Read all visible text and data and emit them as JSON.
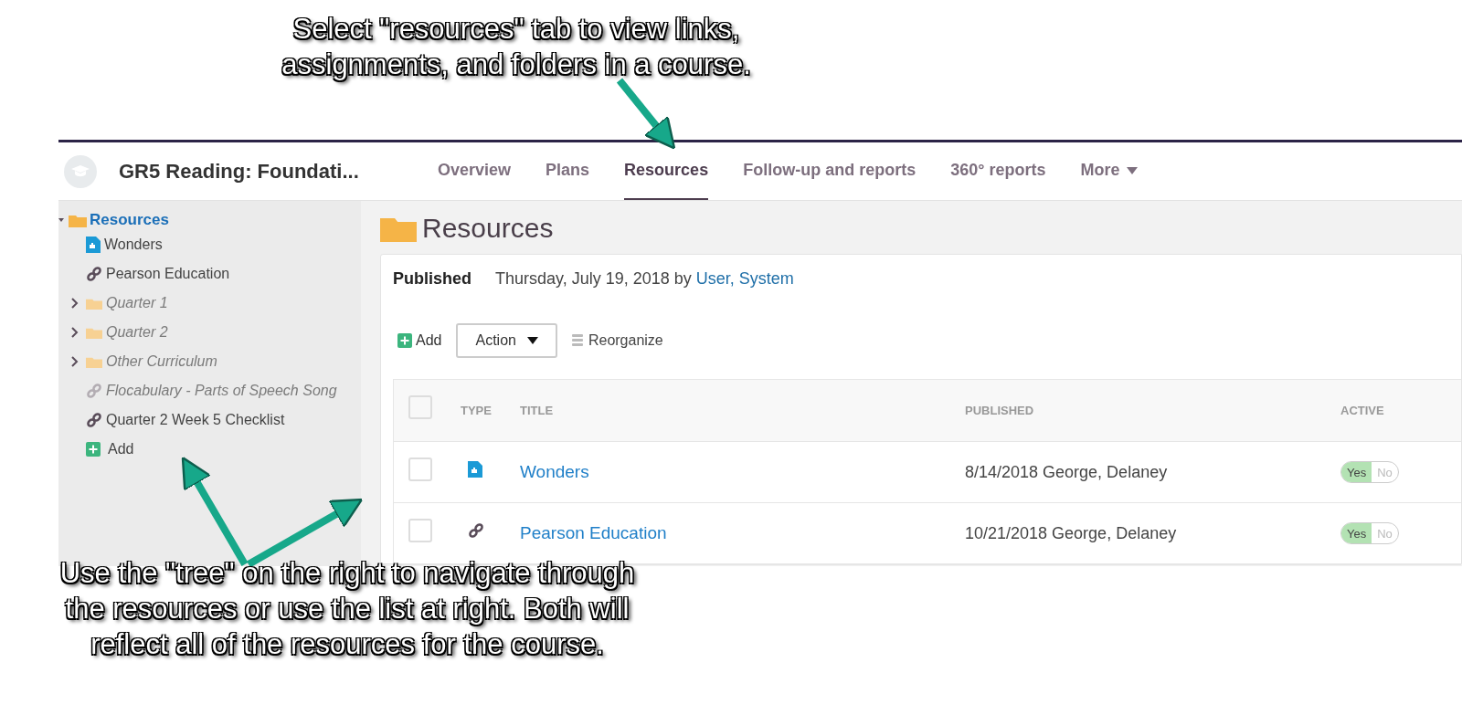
{
  "annotations": [
    {
      "kind": "top",
      "lines": [
        "Select \"resources\" tab to view links,",
        "assignments, and folders in a course."
      ]
    },
    {
      "kind": "bottom",
      "lines": [
        "Use the \"tree\" on the right to navigate through",
        "the resources or use the list at right. Both will",
        "reflect all of the resources for the course."
      ]
    }
  ],
  "header": {
    "course_title": "GR5 Reading: Foundati...",
    "tabs": [
      {
        "label": "Overview",
        "selected": false
      },
      {
        "label": "Plans",
        "selected": false
      },
      {
        "label": "Resources",
        "selected": true
      },
      {
        "label": "Follow-up and reports",
        "selected": false
      },
      {
        "label": "360° reports",
        "selected": false
      },
      {
        "label": "More",
        "selected": false,
        "dropdown": true
      }
    ]
  },
  "tree": {
    "label": "Resources",
    "expanded": true,
    "children": [
      {
        "kind": "document",
        "label": "Wonders",
        "hidden": false
      },
      {
        "kind": "link",
        "label": "Pearson Education",
        "hidden": false
      },
      {
        "kind": "folder",
        "label": "Quarter 1",
        "hidden": true,
        "expanded": false
      },
      {
        "kind": "folder",
        "label": "Quarter 2",
        "hidden": true,
        "expanded": false
      },
      {
        "kind": "folder",
        "label": "Other Curriculum",
        "hidden": true,
        "expanded": false
      },
      {
        "kind": "link",
        "label": "Flocabulary - Parts of Speech Song",
        "hidden": true
      },
      {
        "kind": "link",
        "label": "Quarter 2 Week 5 Checklist",
        "hidden": false
      },
      {
        "kind": "add",
        "label": "Add",
        "hidden": false
      }
    ]
  },
  "main": {
    "title": "Resources",
    "published_label": "Published",
    "published_text": "Thursday, July 19, 2018 by",
    "published_by": "User, System",
    "toolbar": {
      "add": "Add",
      "action": "Action",
      "reorganize": "Reorganize"
    },
    "table": {
      "select_all_checked": false,
      "columns": [
        "TYPE",
        "TITLE",
        "PUBLISHED",
        "ACTIVE"
      ],
      "rows": [
        {
          "kind": "document",
          "title": "Wonders",
          "published": "8/14/2018 George, Delaney",
          "checked": false,
          "active": true,
          "yes": "Yes",
          "no": "No"
        },
        {
          "kind": "link",
          "title": "Pearson Education",
          "published": "10/21/2018 George, Delaney",
          "checked": false,
          "active": true,
          "yes": "Yes",
          "no": "No"
        }
      ]
    }
  }
}
